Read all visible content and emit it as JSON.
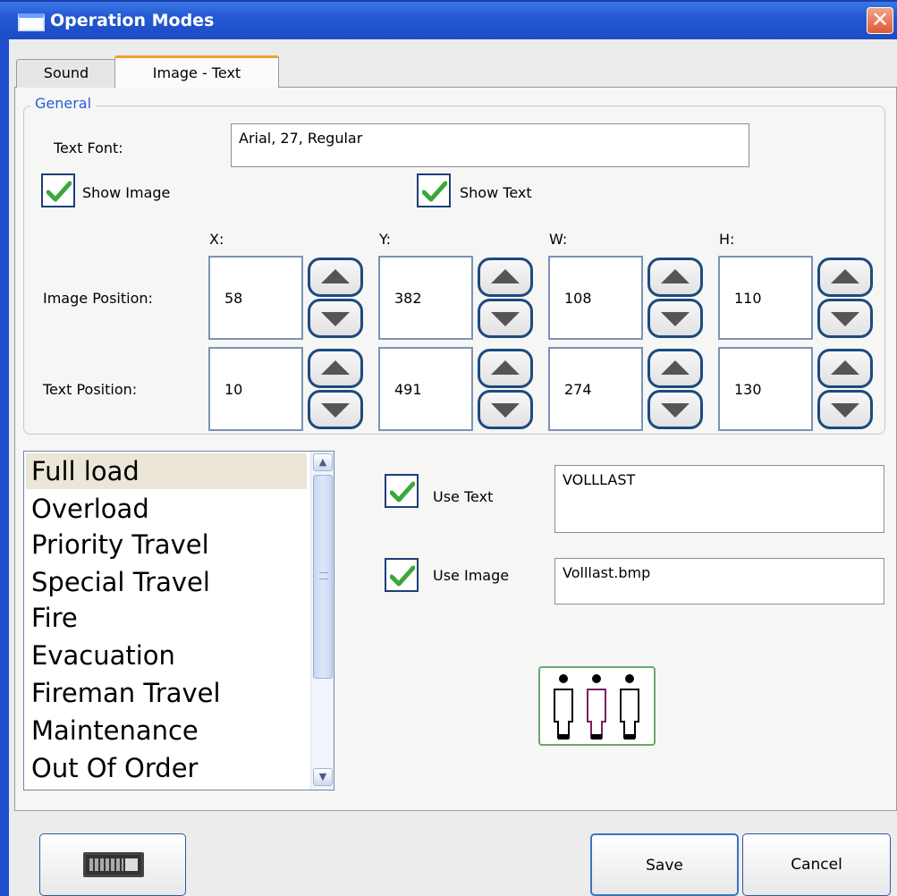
{
  "window": {
    "title": "Operation Modes",
    "close_glyph": "✕"
  },
  "tabs": [
    {
      "label": "Sound",
      "active": false
    },
    {
      "label": "Image - Text",
      "active": true
    }
  ],
  "general": {
    "group_title": "General",
    "text_font_label": "Text Font:",
    "text_font_value": "Arial, 27, Regular",
    "show_image": {
      "label": "Show Image",
      "checked": true
    },
    "show_text": {
      "label": "Show Text",
      "checked": true
    },
    "column_headers": [
      "X:",
      "Y:",
      "W:",
      "H:"
    ],
    "image_position": {
      "label": "Image Position:",
      "values": [
        "58",
        "382",
        "108",
        "110"
      ]
    },
    "text_position": {
      "label": "Text Position:",
      "values": [
        "10",
        "491",
        "274",
        "130"
      ]
    }
  },
  "modes": {
    "items": [
      "Full load",
      "Overload",
      "Priority Travel",
      "Special Travel",
      "Fire",
      "Evacuation",
      "Fireman Travel",
      "Maintenance",
      "Out Of Order"
    ],
    "selected": "Full load"
  },
  "detail": {
    "use_text": {
      "label": "Use Text",
      "checked": true,
      "value": "VOLLLAST"
    },
    "use_image": {
      "label": "Use Image",
      "checked": true,
      "value": "Volllast.bmp"
    },
    "preview_icon": "three-persons-icon"
  },
  "footer": {
    "keyboard_icon": "keyboard-icon",
    "save_label": "Save",
    "cancel_label": "Cancel"
  },
  "colors": {
    "titlebar": "#2458d2",
    "accent": "#2a5cd8",
    "check": "#3aa83a",
    "tab_highlight": "#f0a030"
  }
}
